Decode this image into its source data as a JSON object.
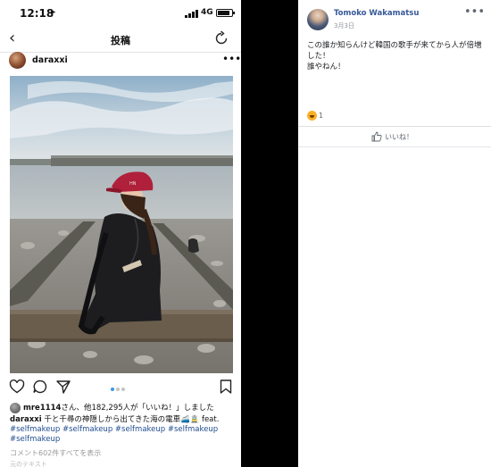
{
  "phone": {
    "status_time": "12:18",
    "network": "4G",
    "nav_title": "投稿",
    "username": "daraxxi",
    "likes_user": "mre1114",
    "likes_text": "さん、他182,295人が「いいね！」しました",
    "caption_user": "daraxxi",
    "caption_text": "千と千尋の神隠しから出てきた海の電車🚄🚊 feat.",
    "hashtags_line1": "#selfmakeup #selfmakeup #selfmakeup #selfmakeup",
    "hashtags_line2": "#selfmakeup",
    "comments_link": "コメント602件すべてを表示",
    "faded_line": "元のテキスト",
    "carousel": {
      "count": 3,
      "active": 1
    }
  },
  "fb": {
    "name": "Tomoko Wakamatsu",
    "date": "3月3日",
    "text_lines": [
      "この誰か知らんけど韓国の歌手が来てから人が倍増",
      "した！",
      "誰やねん！"
    ],
    "reaction_count": "1",
    "like_label": "いいね！"
  },
  "colors": {
    "fb_link": "#365899",
    "hashtag": "#1f4c8f",
    "hat": "#b0203a",
    "carousel_active": "#3897f0"
  }
}
